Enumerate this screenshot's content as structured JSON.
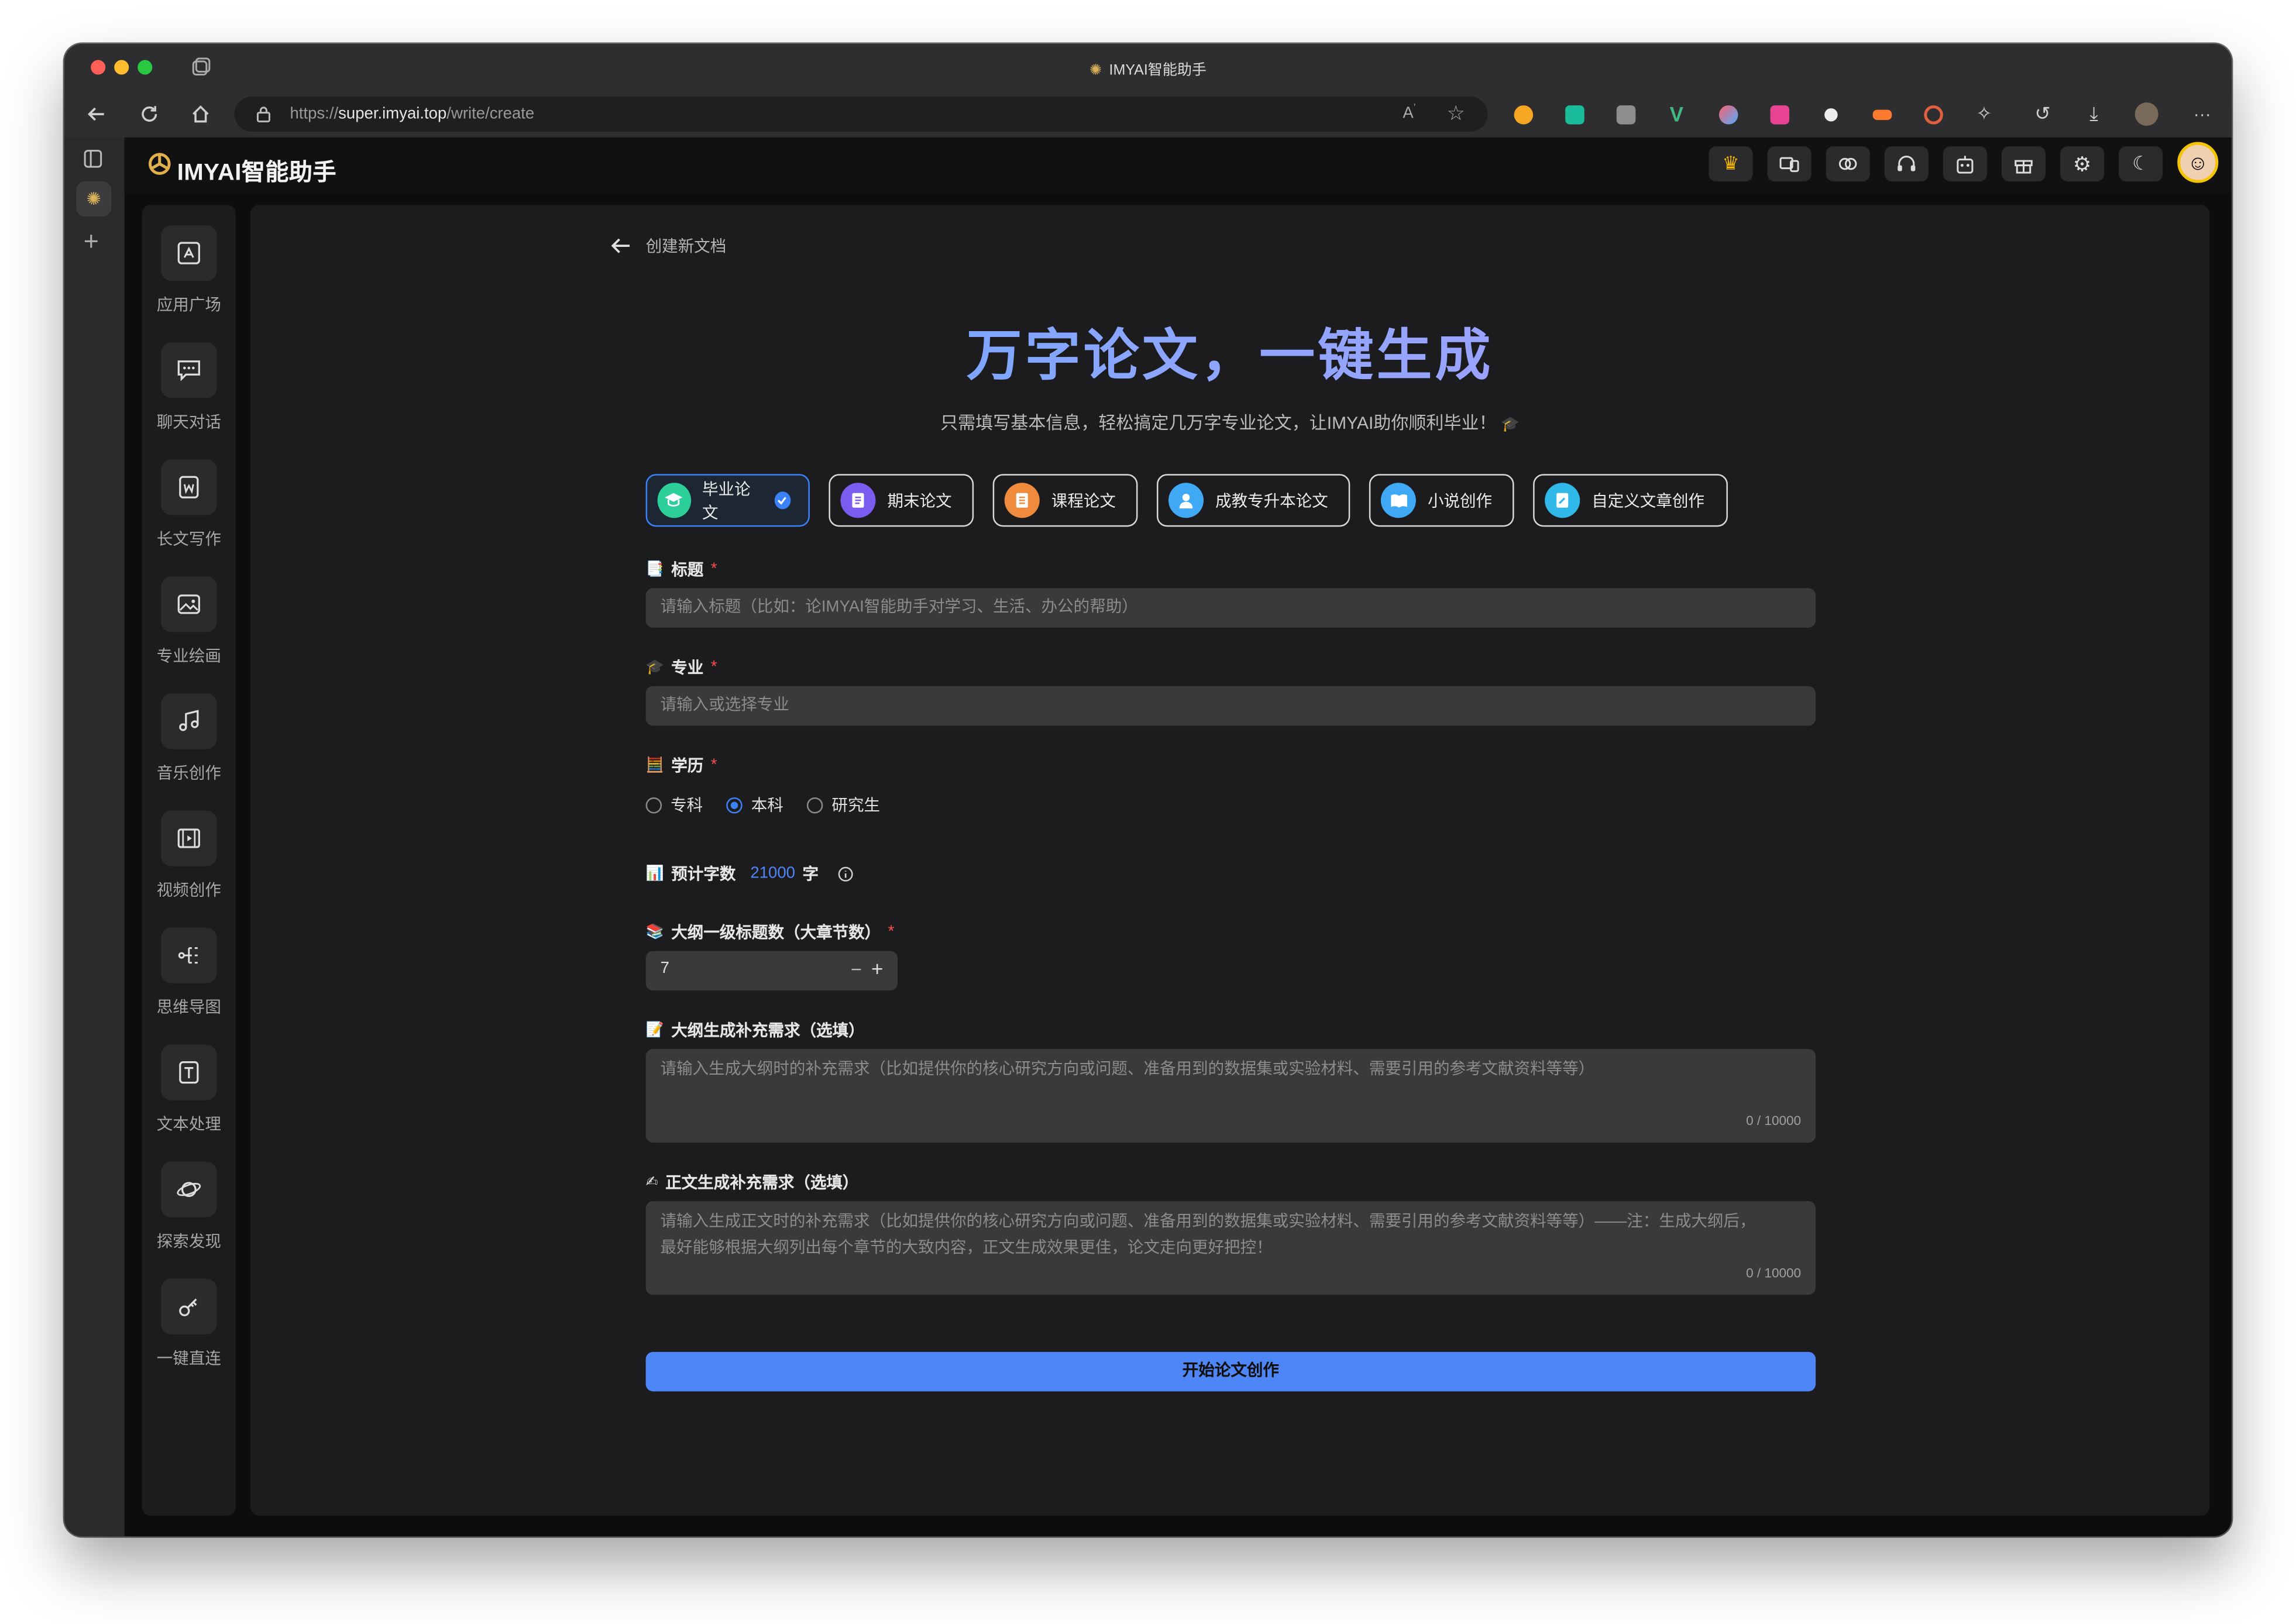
{
  "browser": {
    "window_title": "IMYAI智能助手",
    "url_prefix": "https://",
    "url_host": "super.imyai.top",
    "url_path": "/write/create"
  },
  "app": {
    "brand": "IMYAI智能助手",
    "header_icons": [
      "crown-icon",
      "devices-icon",
      "link-icon",
      "support-icon",
      "robot-icon",
      "gift-icon",
      "settings-icon",
      "moon-icon"
    ]
  },
  "sidebar": {
    "items": [
      {
        "label": "应用广场",
        "icon": "app-square-icon"
      },
      {
        "label": "聊天对话",
        "icon": "chat-icon"
      },
      {
        "label": "长文写作",
        "icon": "word-doc-icon"
      },
      {
        "label": "专业绘画",
        "icon": "image-icon"
      },
      {
        "label": "音乐创作",
        "icon": "music-icon"
      },
      {
        "label": "视频创作",
        "icon": "video-icon"
      },
      {
        "label": "思维导图",
        "icon": "mindmap-icon"
      },
      {
        "label": "文本处理",
        "icon": "text-icon"
      },
      {
        "label": "探索发现",
        "icon": "planet-icon"
      },
      {
        "label": "一键直连",
        "icon": "key-icon"
      }
    ]
  },
  "page": {
    "breadcrumb": "创建新文档",
    "hero_title": "万字论文，一键生成",
    "subtitle": "只需填写基本信息，轻松搞定几万字专业论文，让IMYAI助你顺利毕业！",
    "doc_types": [
      {
        "label": "毕业论文",
        "active": true,
        "color": "#2ccf9a"
      },
      {
        "label": "期末论文",
        "active": false,
        "color": "#7b5cf0"
      },
      {
        "label": "课程论文",
        "active": false,
        "color": "#f08a3c"
      },
      {
        "label": "成教专升本论文",
        "active": false,
        "color": "#3fa9f5"
      },
      {
        "label": "小说创作",
        "active": false,
        "color": "#3fa9f5"
      },
      {
        "label": "自定义文章创作",
        "active": false,
        "color": "#2fb8e8"
      }
    ],
    "title_field": {
      "label": "标题",
      "required": "*",
      "placeholder": "请输入标题（比如：论IMYAI智能助手对学习、生活、办公的帮助）"
    },
    "major_field": {
      "label": "专业",
      "required": "*",
      "placeholder": "请输入或选择专业"
    },
    "degree_field": {
      "label": "学历",
      "required": "*",
      "options": [
        "专科",
        "本科",
        "研究生"
      ],
      "selected": "本科"
    },
    "word_count": {
      "label": "预计字数",
      "value": "21000",
      "unit": "字"
    },
    "outline_count": {
      "label": "大纲一级标题数（大章节数）",
      "required": "*",
      "value": "7",
      "minus": "−",
      "plus": "+"
    },
    "outline_extra": {
      "label": "大纲生成补充需求（选填）",
      "placeholder": "请输入生成大纲时的补充需求（比如提供你的核心研究方向或问题、准备用到的数据集或实验材料、需要引用的参考文献资料等等）",
      "counter": "0 / 10000"
    },
    "body_extra": {
      "label": "正文生成补充需求（选填）",
      "placeholder_line1": "请输入生成正文时的补充需求（比如提供你的核心研究方向或问题、准备用到的数据集或实验材料、需要引用的参考文献资料等等）——注：生成大纲后，",
      "placeholder_line2": "最好能够根据大纲列出每个章节的大致内容，正文生成效果更佳，论文走向更好把控！",
      "counter": "0 / 10000"
    },
    "submit_label": "开始论文创作"
  },
  "colors": {
    "accent": "#3b82f6",
    "submit": "#4f86f7",
    "required": "#ff4d4f",
    "word_count": "#4f86f7"
  }
}
